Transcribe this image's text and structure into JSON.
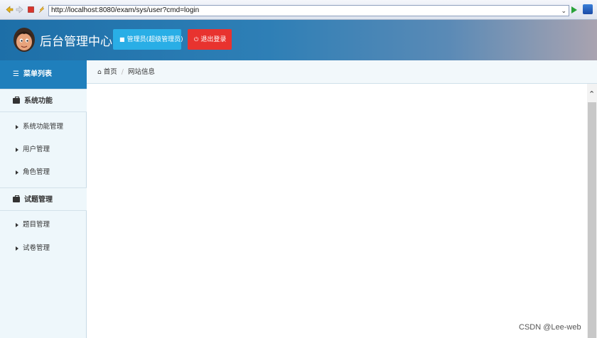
{
  "browser": {
    "url": "http://localhost:8080/exam/sys/user?cmd=login"
  },
  "header": {
    "title": "后台管理中心",
    "admin_button": "管理员(超级管理员)",
    "logout_button": "退出登录"
  },
  "sidebar": {
    "menu_title": "菜单列表",
    "groups": [
      {
        "label": "系统功能",
        "items": [
          "系统功能管理",
          "用户管理",
          "角色管理"
        ]
      },
      {
        "label": "试题管理",
        "items": [
          "题目管理",
          "试卷管理"
        ]
      }
    ]
  },
  "breadcrumb": {
    "home": "首页",
    "current": "网站信息"
  },
  "watermark": "CSDN @Lee-web",
  "colors": {
    "accent_blue": "#29aee6",
    "logout_red": "#e8332f",
    "menu_header": "#1f7fbc"
  }
}
